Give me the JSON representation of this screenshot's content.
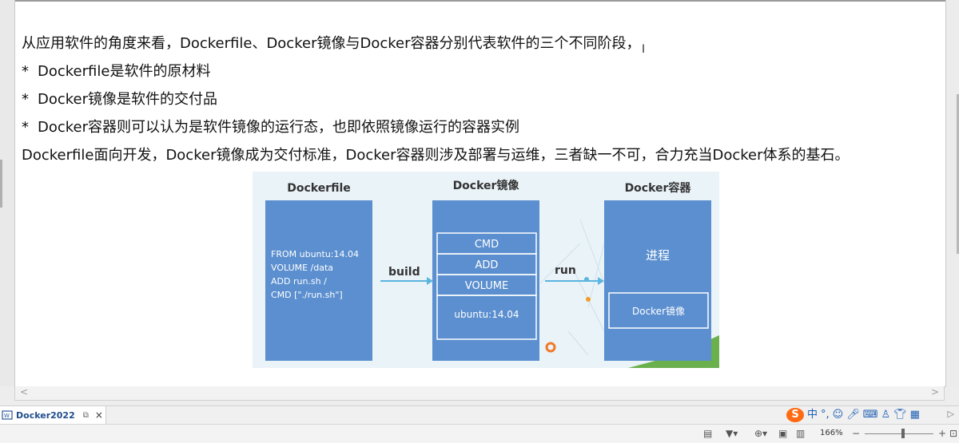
{
  "document": {
    "lines": {
      "intro": "从应用软件的角度来看，Dockerfile、Docker镜像与Docker容器分别代表软件的三个不同阶段，",
      "b1": "Dockerfile是软件的原材料",
      "b2": "Docker镜像是软件的交付品",
      "b3": "Docker容器则可以认为是软件镜像的运行态，也即依照镜像运行的容器实例",
      "summary": "Dockerfile面向开发，Docker镜像成为交付标准，Docker容器则涉及部署与运维，三者缺一不可，合力充当Docker体系的基石。"
    },
    "bullet_char": "*",
    "figure": {
      "col1_title": "Dockerfile",
      "col2_title": "Docker镜像",
      "col3_title": "Docker容器",
      "code": [
        "FROM ubuntu:14.04",
        "VOLUME /data",
        "ADD run.sh /",
        "CMD [\"./run.sh\"]"
      ],
      "arrow1": "build",
      "arrow2": "run",
      "layers": [
        "CMD",
        "ADD",
        "VOLUME",
        "ubuntu:14.04"
      ],
      "process": "进程",
      "inner_image": "Docker镜像"
    }
  },
  "tabs": {
    "doc_name": "Docker2022",
    "close": "×"
  },
  "ime": {
    "logo": "S",
    "lang": "中"
  },
  "status": {
    "zoom": "166%",
    "minus": "−",
    "plus": "+"
  },
  "scroll": {
    "left": "<",
    "right": ">"
  },
  "colors": {
    "box_blue": "#5b8fcf",
    "figure_bg": "#eaf3f8",
    "ime_orange": "#ff6a13"
  }
}
